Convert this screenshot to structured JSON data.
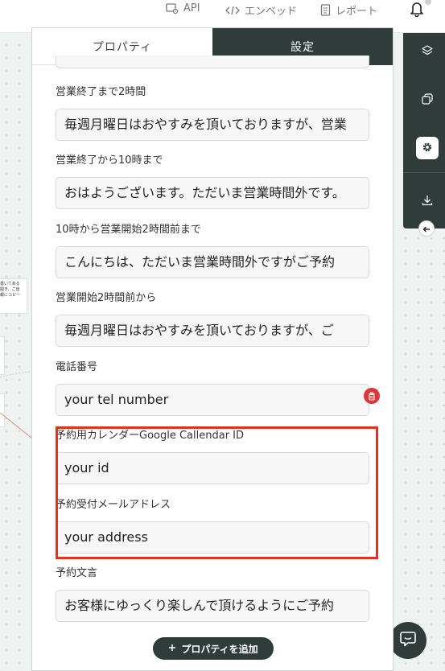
{
  "topbar": {
    "api_label": "API",
    "embed_label": "エンベッド",
    "report_label": "レポート"
  },
  "panel": {
    "tabs": [
      {
        "label": "プロパティ",
        "active": true
      },
      {
        "label": "設定",
        "active": false
      }
    ],
    "fields": [
      {
        "label": "営業終了まで2時間",
        "value": "毎週月曜日はおやすみを頂いておりますが、営業"
      },
      {
        "label": "営業終了から10時まで",
        "value": "おはようございます。ただいま営業時間外です。"
      },
      {
        "label": "10時から営業開始2時間前まで",
        "value": "こんにちは、ただいま営業時間外ですがご予約"
      },
      {
        "label": "営業開始2時間前から",
        "value": "毎週月曜日はおやすみを頂いておりますが、ご"
      },
      {
        "label": "電話番号",
        "value": "your tel number"
      },
      {
        "label": "予約用カレンダーGoogle Callendar ID",
        "value": "your id"
      },
      {
        "label": "予約受付メールアドレス",
        "value": "your address"
      },
      {
        "label": "予約文言",
        "value": "お客様にゆっくり楽しんで頂けるようにご予約"
      }
    ],
    "add_property_label": "プロパティを追加"
  },
  "canvas": {
    "scrap_text": "に書いてある\nを開き、ご自\n情報にコピー\nり"
  },
  "colors": {
    "dark": "#2f3c3a",
    "highlight": "#e2321b",
    "delete": "#d9383a"
  },
  "icons": {
    "api": "api-gear-icon",
    "embed": "code-icon",
    "report": "document-icon",
    "notifications": "bell-icon",
    "rail": [
      "layers-icon",
      "copy-icon",
      "gear-icon",
      "download-icon"
    ],
    "collapse": "arrow-left-icon",
    "chat": "chat-icon",
    "delete": "trash-icon",
    "add": "plus-icon"
  }
}
